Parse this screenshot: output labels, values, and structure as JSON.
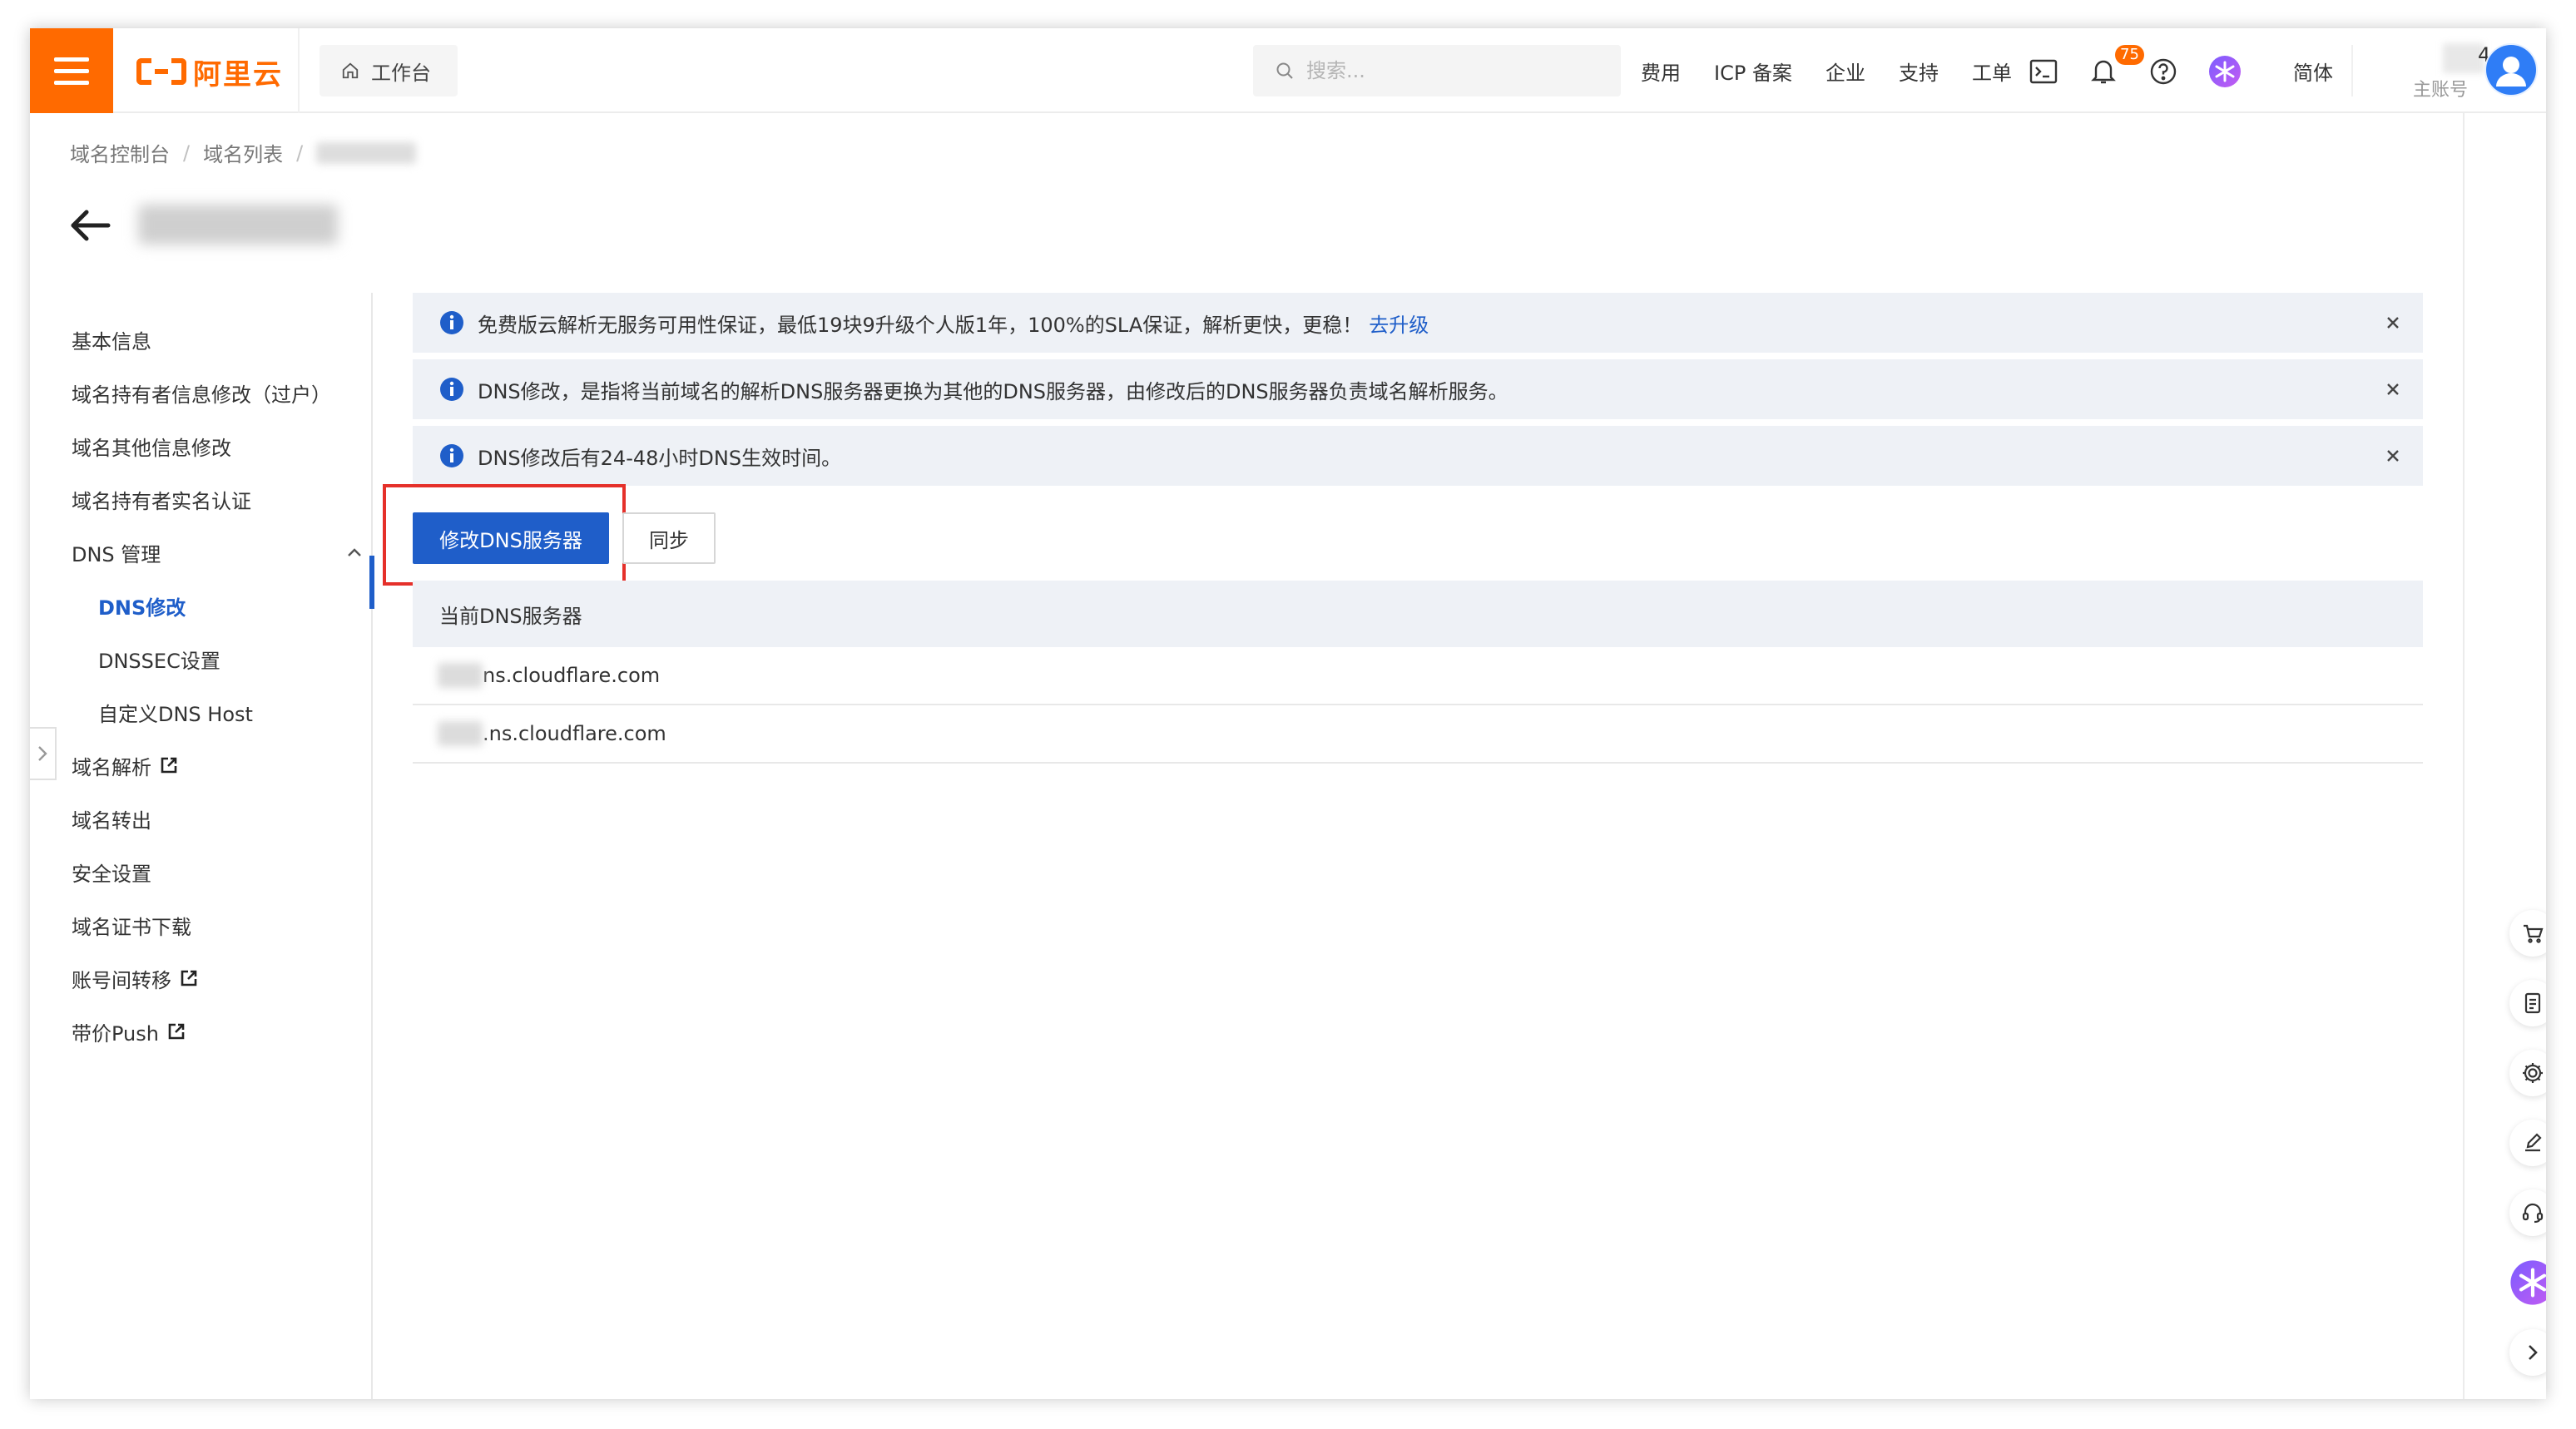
{
  "header": {
    "logo_text": "阿里云",
    "workbench_label": "工作台",
    "search_placeholder": "搜索...",
    "nav": [
      "费用",
      "ICP 备案",
      "企业",
      "支持",
      "工单"
    ],
    "notification_count": "75",
    "language": "简体",
    "account_suffix": "4",
    "account_label": "主账号"
  },
  "breadcrumb": [
    "域名控制台",
    "域名列表"
  ],
  "sidebar": {
    "items": [
      {
        "label": "基本信息"
      },
      {
        "label": "域名持有者信息修改（过户）"
      },
      {
        "label": "域名其他信息修改"
      },
      {
        "label": "域名持有者实名认证"
      },
      {
        "label": "DNS 管理"
      },
      {
        "label": "DNS修改"
      },
      {
        "label": "DNSSEC设置"
      },
      {
        "label": "自定义DNS Host"
      },
      {
        "label": "域名解析"
      },
      {
        "label": "域名转出"
      },
      {
        "label": "安全设置"
      },
      {
        "label": "域名证书下载"
      },
      {
        "label": "账号间转移"
      },
      {
        "label": "带价Push"
      }
    ]
  },
  "notices": [
    {
      "text": "免费版云解析无服务可用性保证，最低19块9升级个人版1年，100%的SLA保证，解析更快，更稳！",
      "link": "去升级"
    },
    {
      "text": "DNS修改，是指将当前域名的解析DNS服务器更换为其他的DNS服务器，由修改后的DNS服务器负责域名解析服务。"
    },
    {
      "text": "DNS修改后有24-48小时DNS生效时间。"
    }
  ],
  "actions": {
    "modify_dns_label": "修改DNS服务器",
    "sync_label": "同步"
  },
  "dns_table": {
    "header": "当前DNS服务器",
    "rows": [
      "ns.cloudflare.com",
      ".ns.cloudflare.com"
    ]
  },
  "colors": {
    "brand_orange": "#ff6a00",
    "primary_blue": "#1f5ec9",
    "highlight_red": "#e5302a",
    "notice_bg": "#eef1f6"
  }
}
